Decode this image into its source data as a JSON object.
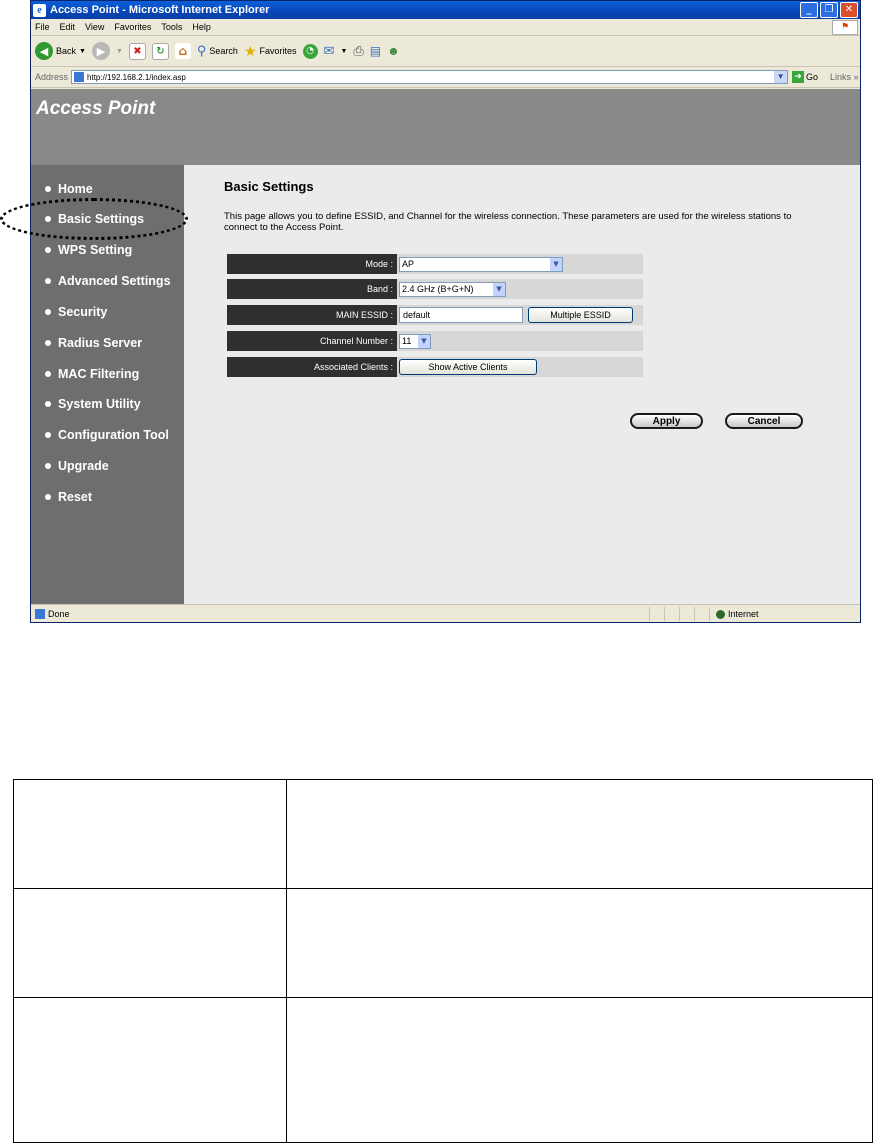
{
  "window": {
    "title": "Access Point - Microsoft Internet Explorer",
    "controls": [
      "_",
      "❐",
      "✕"
    ]
  },
  "menubar": [
    "File",
    "Edit",
    "View",
    "Favorites",
    "Tools",
    "Help"
  ],
  "toolbar": {
    "back": "Back",
    "search": "Search",
    "favorites": "Favorites"
  },
  "address": {
    "label": "Address",
    "url": "http://192.168.2.1/index.asp",
    "go": "Go",
    "links": "Links"
  },
  "page": {
    "brand": "Access Point",
    "nav": [
      {
        "label": "Home"
      },
      {
        "label": "Basic Settings"
      },
      {
        "label": "WPS Setting"
      },
      {
        "label": "Advanced Settings"
      },
      {
        "label": "Security"
      },
      {
        "label": "Radius Server"
      },
      {
        "label": "MAC Filtering"
      },
      {
        "label": "System Utility"
      },
      {
        "label": "Configuration Tool"
      },
      {
        "label": "Upgrade"
      },
      {
        "label": "Reset"
      }
    ],
    "heading": "Basic Settings",
    "description": "This page allows you to define ESSID, and Channel for the wireless connection. These parameters are used for the wireless stations to connect to the Access Point.",
    "form": {
      "mode_label": "Mode :",
      "mode_value": "AP",
      "band_label": "Band :",
      "band_value": "2.4 GHz (B+G+N)",
      "essid_label": "MAIN ESSID :",
      "essid_value": "default",
      "multiple_essid": "Multiple ESSID",
      "channel_label": "Channel Number :",
      "channel_value": "11",
      "clients_label": "Associated Clients :",
      "show_clients": "Show Active Clients"
    },
    "apply": "Apply",
    "cancel": "Cancel"
  },
  "status": {
    "text": "Done",
    "zone": "Internet"
  },
  "colors": {
    "banner": "#898989",
    "sidebar": "#6e6e6e",
    "label_bg": "#2f2f2f",
    "content_bg": "#ebebeb"
  }
}
